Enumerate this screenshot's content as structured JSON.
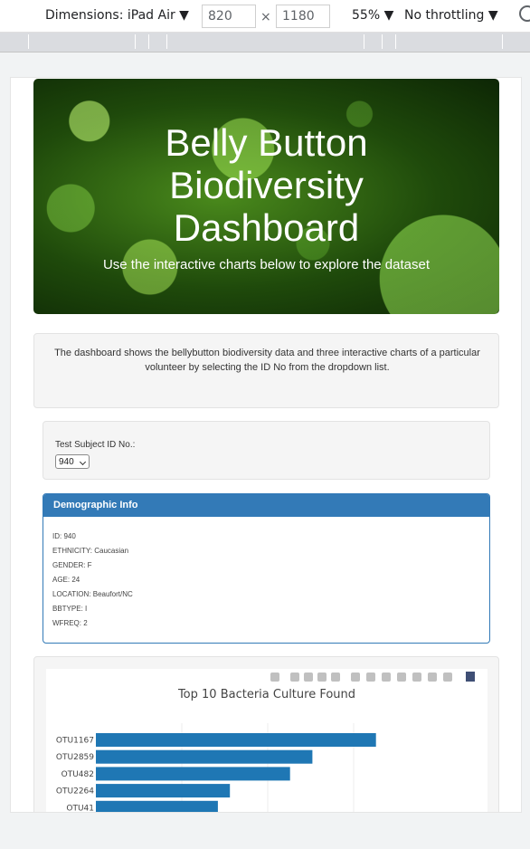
{
  "devtools": {
    "dimensions_label": "Dimensions: iPad Air ▼",
    "width": "820",
    "times": "×",
    "height": "1180",
    "zoom": "55% ▼",
    "throttling": "No throttling ▼"
  },
  "header": {
    "title": "Belly Button\nBiodiversity\nDashboard",
    "subtitle": "Use the interactive charts below to explore the dataset"
  },
  "intro": {
    "text": "The dashboard shows the bellybutton biodiversity data and three interactive charts of a particular volunteer by selecting the ID No from the dropdown list."
  },
  "selector": {
    "label": "Test Subject ID No.:",
    "value": "940"
  },
  "demographic": {
    "heading": "Demographic Info",
    "lines": [
      "ID: 940",
      "ETHNICITY: Caucasian",
      "GENDER: F",
      "AGE: 24",
      "LOCATION: Beaufort/NC",
      "BBTYPE: I",
      "WFREQ: 2"
    ]
  },
  "chart_data": {
    "type": "bar",
    "orientation": "horizontal",
    "title": "Top 10 Bacteria Culture Found",
    "categories": [
      "OTU1167",
      "OTU2859",
      "OTU482",
      "OTU2264",
      "OTU41"
    ],
    "values": [
      163,
      126,
      113,
      78,
      71
    ],
    "xlim": [
      0,
      200
    ],
    "grid": true,
    "bar_color": "#1f77b4"
  }
}
